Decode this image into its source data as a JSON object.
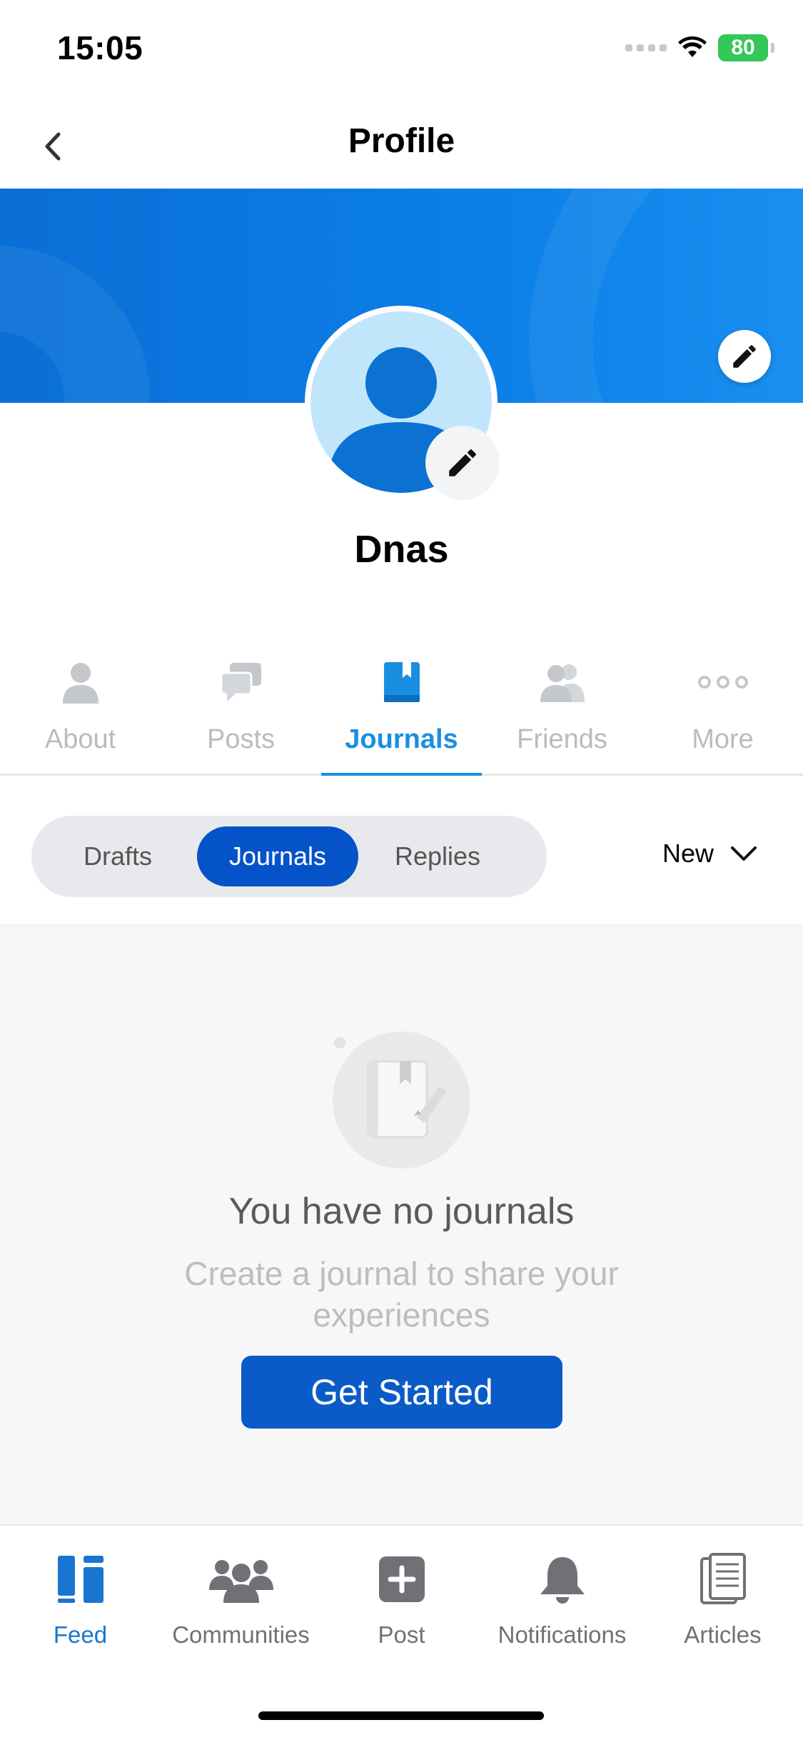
{
  "status_bar": {
    "time": "15:05",
    "battery": "80"
  },
  "nav": {
    "title": "Profile"
  },
  "profile": {
    "name": "Dnas"
  },
  "tabs": [
    {
      "label": "About",
      "icon": "person-icon",
      "active": false
    },
    {
      "label": "Posts",
      "icon": "chat-bubbles-icon",
      "active": false
    },
    {
      "label": "Journals",
      "icon": "book-icon",
      "active": true
    },
    {
      "label": "Friends",
      "icon": "friends-icon",
      "active": false
    },
    {
      "label": "More",
      "icon": "more-dots-icon",
      "active": false
    }
  ],
  "segments": {
    "drafts": "Drafts",
    "journals": "Journals",
    "replies": "Replies",
    "selected": "Journals"
  },
  "sort": {
    "label": "New"
  },
  "empty_state": {
    "title": "You have no journals",
    "subtitle": "Create a  journal to share your experiences",
    "button": "Get Started"
  },
  "bottom_nav": [
    {
      "label": "Feed",
      "icon": "feed-icon",
      "active": true
    },
    {
      "label": "Communities",
      "icon": "communities-icon",
      "active": false
    },
    {
      "label": "Post",
      "icon": "add-post-icon",
      "active": false
    },
    {
      "label": "Notifications",
      "icon": "bell-icon",
      "active": false
    },
    {
      "label": "Articles",
      "icon": "articles-icon",
      "active": false
    }
  ],
  "colors": {
    "primary": "#0553c8",
    "accent": "#1a8fe0",
    "banner": "#0b7fe8"
  }
}
